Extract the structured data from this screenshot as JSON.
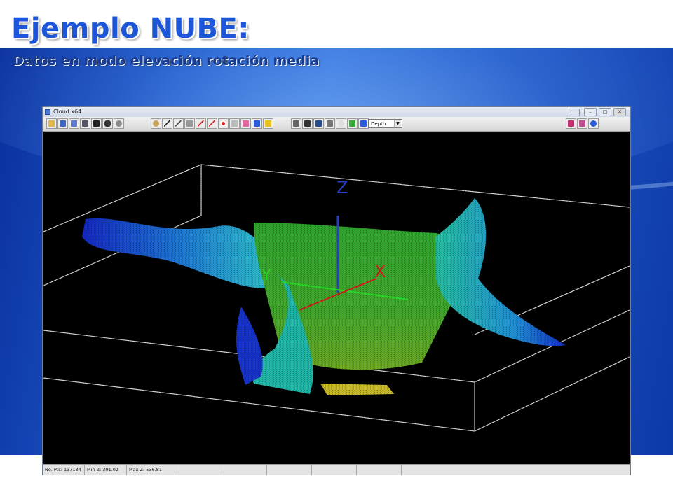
{
  "slide": {
    "title": "Ejemplo NUBE:",
    "subtitle": "Datos en modo elevación rotación media"
  },
  "window": {
    "title": "Cloud x64",
    "controls": {
      "minimize": "–",
      "maximize": "□",
      "close": "✕"
    }
  },
  "toolbar": {
    "depth_select_value": "Depth",
    "groups": [
      {
        "name": "file",
        "icons": [
          "open-icon",
          "save-icon",
          "save-as-icon",
          "print-icon",
          "export-icon",
          "camera-icon",
          "globe-icon"
        ]
      },
      {
        "name": "tools",
        "icons": [
          "zoom-icon",
          "measure-icon",
          "line-icon",
          "xyz-icon",
          "ruler-red-icon",
          "pencil-icon",
          "target-icon",
          "undo-icon",
          "eraser-icon",
          "delete-x-icon",
          "lightning-icon"
        ]
      },
      {
        "name": "view",
        "icons": [
          "fit-icon",
          "cursor-icon",
          "grid-icon",
          "box-icon",
          "light-icon",
          "arrow-up-icon",
          "flag-icon"
        ]
      },
      {
        "name": "help",
        "icons": [
          "book-icon",
          "palette-icon",
          "help-icon"
        ]
      }
    ]
  },
  "viewport": {
    "axis_labels": {
      "z": "Z",
      "x": "X",
      "y": "Y"
    },
    "colors": {
      "background": "#000000",
      "box": "#d8d8d8",
      "z_axis": "#2a3fbf",
      "x_axis": "#d01818",
      "y_axis": "#26d726"
    }
  },
  "status": {
    "points": "No. Pts: 137184",
    "min_z": "Min Z: 391.02",
    "max_z": "Max Z: 536.81"
  }
}
